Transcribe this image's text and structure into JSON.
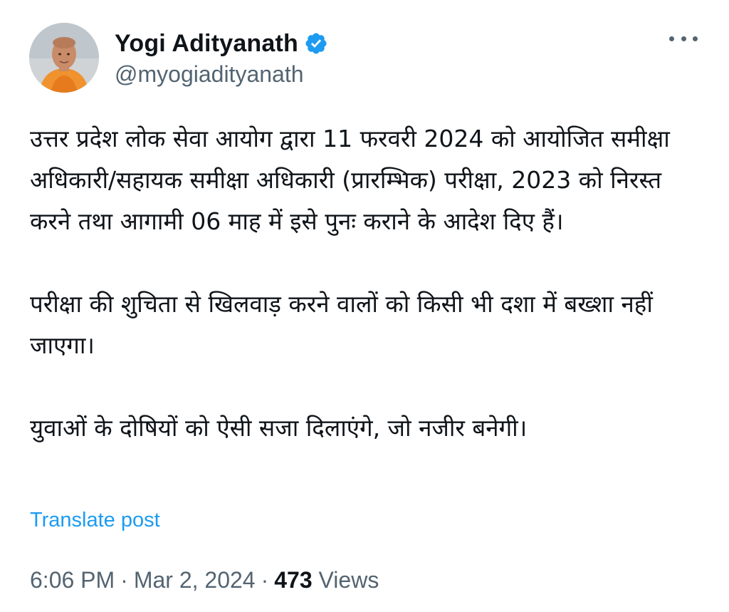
{
  "author": {
    "display_name": "Yogi Adityanath",
    "handle": "@myogiadityanath",
    "verified": true,
    "avatar_icon": "profile-photo"
  },
  "post": {
    "paragraphs": [
      "उत्तर प्रदेश लोक सेवा आयोग द्वारा 11 फरवरी 2024 को आयोजित समीक्षा अधिकारी/सहायक समीक्षा अधिकारी (प्रारम्भिक) परीक्षा, 2023 को निरस्त करने तथा आगामी 06 माह में इसे पुनः कराने के आदेश दिए हैं।",
      "परीक्षा की शुचिता से खिलवाड़ करने वालों को किसी भी दशा में बख्शा नहीं जाएगा।",
      "युवाओं के दोषियों को ऐसी सजा दिलाएंगे, जो नजीर बनेगी।"
    ],
    "translate_label": "Translate post"
  },
  "meta": {
    "time": "6:06 PM",
    "separator": "·",
    "date": "Mar 2, 2024",
    "views_count": "473",
    "views_label": "Views"
  },
  "colors": {
    "text": "#0f1419",
    "secondary": "#536471",
    "accent": "#1d9bf0"
  }
}
